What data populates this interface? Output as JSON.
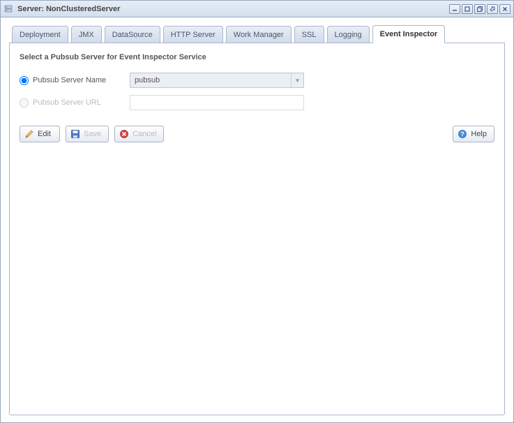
{
  "window": {
    "title_prefix": "Server:",
    "title_name": "NonClusteredServer"
  },
  "tabs": [
    {
      "label": "Deployment",
      "active": false
    },
    {
      "label": "JMX",
      "active": false
    },
    {
      "label": "DataSource",
      "active": false
    },
    {
      "label": "HTTP Server",
      "active": false
    },
    {
      "label": "Work Manager",
      "active": false
    },
    {
      "label": "SSL",
      "active": false
    },
    {
      "label": "Logging",
      "active": false
    },
    {
      "label": "Event Inspector",
      "active": true
    }
  ],
  "panel": {
    "heading": "Select a Pubsub Server for Event Inspector Service",
    "radio_name_label": "Pubsub Server Name",
    "radio_url_label": "Pubsub Server URL",
    "server_name_value": "pubsub",
    "server_url_value": ""
  },
  "buttons": {
    "edit": "Edit",
    "save": "Save",
    "cancel": "Cancel",
    "help": "Help"
  }
}
